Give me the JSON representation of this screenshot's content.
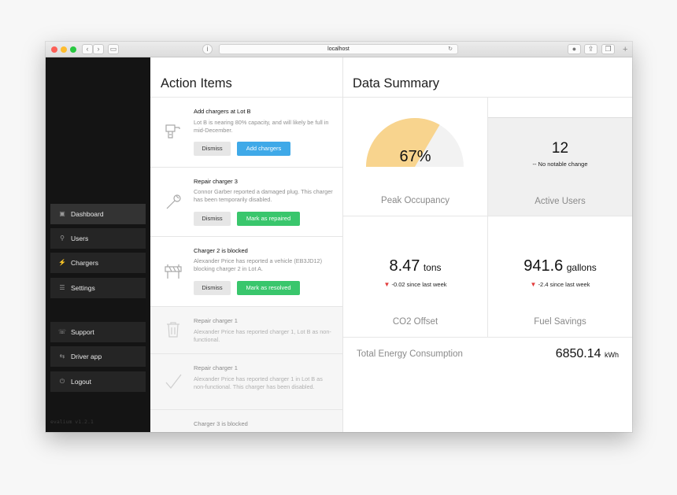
{
  "browser": {
    "url": "localhost",
    "traffic_lights": [
      "#fd5f57",
      "#febc2e",
      "#28c840"
    ]
  },
  "sidebar": {
    "items": [
      {
        "label": "Dashboard",
        "icon": "dashboard-icon",
        "glyph": "▣",
        "active": true
      },
      {
        "label": "Users",
        "icon": "user-icon",
        "glyph": "⚲",
        "active": false
      },
      {
        "label": "Chargers",
        "icon": "plug-icon",
        "glyph": "⚡",
        "active": false
      },
      {
        "label": "Settings",
        "icon": "sliders-icon",
        "glyph": "☰",
        "active": false
      }
    ],
    "bottom_items": [
      {
        "label": "Support",
        "icon": "support-icon",
        "glyph": "☏"
      },
      {
        "label": "Driver app",
        "icon": "car-icon",
        "glyph": "⇆"
      },
      {
        "label": "Logout",
        "icon": "power-icon",
        "glyph": "⏻"
      }
    ],
    "version": "evalium v1.2.1"
  },
  "actions": {
    "title": "Action Items",
    "cards": [
      {
        "title": "Add chargers at Lot B",
        "desc": "Lot B is nearing 80% capacity, and will likely be full in mid-December.",
        "dismiss": "Dismiss",
        "action": "Add chargers",
        "icon": "drill-icon"
      },
      {
        "title": "Repair charger 3",
        "desc": "Connor Garber reported a damaged plug. This charger has been temporarily disabled.",
        "dismiss": "Dismiss",
        "action": "Mark as repaired",
        "icon": "wrench-icon"
      },
      {
        "title": "Charger 2 is blocked",
        "desc": "Alexander Price has reported a vehicle (EB3JD12) blocking charger 2 in Lot A.",
        "dismiss": "Dismiss",
        "action": "Mark as resolved",
        "icon": "barrier-icon"
      },
      {
        "title": "Repair charger 1",
        "desc": "Alexander Price has reported charger 1, Lot B as non-functional.",
        "icon": "trash-icon"
      },
      {
        "title": "Repair charger 1",
        "desc": "Alexander Price has reported charger 1 in Lot B as non-functional. This charger has been disabled.",
        "icon": "check-icon"
      },
      {
        "title": "Charger 3 is blocked",
        "icon": "barrier-icon"
      }
    ]
  },
  "summary": {
    "title": "Data Summary",
    "peak_occupancy": {
      "value": "67%",
      "fraction": 0.67,
      "label": "Peak Occupancy",
      "fill_color": "#f8d48e"
    },
    "active_users": {
      "value": "12",
      "change": "-- No notable change",
      "label": "Active Users"
    },
    "co2": {
      "value": "8.47",
      "unit": "tons",
      "change": "-0.02 since last week",
      "label": "CO2 Offset"
    },
    "fuel": {
      "value": "941.6",
      "unit": "gallons",
      "change": "-2.4 since last week",
      "label": "Fuel Savings"
    },
    "energy": {
      "label": "Total Energy Consumption",
      "value": "6850.14",
      "unit": "kWh"
    }
  }
}
